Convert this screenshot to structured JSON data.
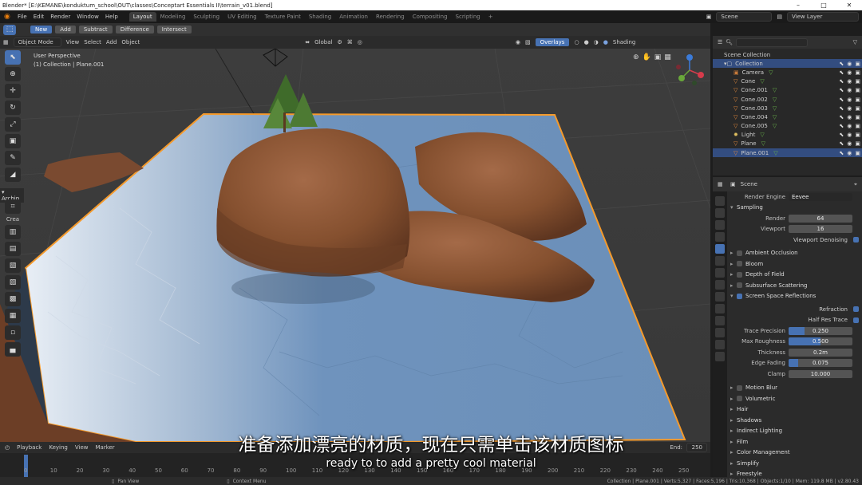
{
  "window": {
    "title": "Blender* [E:\\KEMANE\\konduktum_school\\OUT\\classes\\Conceptart Essentials II\\terrain_v01.blend]"
  },
  "menubar": {
    "menus": [
      "File",
      "Edit",
      "Render",
      "Window",
      "Help"
    ],
    "workspaces": [
      "Layout",
      "Modeling",
      "Sculpting",
      "UV Editing",
      "Texture Paint",
      "Shading",
      "Animation",
      "Rendering",
      "Compositing",
      "Scripting"
    ],
    "active_workspace": "Layout",
    "scene": "Scene",
    "view_layer": "View Layer"
  },
  "tool_header": {
    "new": "New",
    "add": "Add",
    "subtract": "Subtract",
    "difference": "Difference",
    "intersect": "Intersect"
  },
  "viewport_header": {
    "mode": "Object Mode",
    "view": "View",
    "select": "Select",
    "add": "Add",
    "object": "Object",
    "orientation": "Global",
    "overlays": "Overlays",
    "shading": "Shading"
  },
  "viewport": {
    "perspective": "User Perspective",
    "collection_info": "(1) Collection | Plane.001"
  },
  "toolbar": {
    "archip_label": "Archip",
    "crea_label": "Crea"
  },
  "outliner": {
    "root": "Scene Collection",
    "collection": "Collection",
    "items": [
      "Camera",
      "Cone",
      "Cone.001",
      "Cone.002",
      "Cone.003",
      "Cone.004",
      "Cone.005",
      "Light",
      "Plane",
      "Plane.001"
    ]
  },
  "properties": {
    "tab": "Scene",
    "render_engine_label": "Render Engine",
    "render_engine": "Eevee",
    "sampling": {
      "title": "Sampling",
      "render_label": "Render",
      "render": "64",
      "viewport_label": "Viewport",
      "viewport": "16",
      "denoise_label": "Viewport Denoising"
    },
    "sections_top": [
      "Ambient Occlusion",
      "Bloom",
      "Depth of Field",
      "Subsurface Scattering"
    ],
    "ssr": {
      "title": "Screen Space Reflections",
      "refraction": "Refraction",
      "half_res": "Half Res Trace",
      "trace_precision_label": "Trace Precision",
      "trace_precision": "0.250",
      "trace_precision_frac": 0.25,
      "max_roughness_label": "Max Roughness",
      "max_roughness": "0.500",
      "max_roughness_frac": 0.5,
      "thickness_label": "Thickness",
      "thickness": "0.2m",
      "edge_fading_label": "Edge Fading",
      "edge_fading": "0.075",
      "edge_fading_frac": 0.15,
      "clamp_label": "Clamp",
      "clamp": "10.000"
    },
    "sections_bottom": [
      "Motion Blur",
      "Volumetric",
      "Hair",
      "Shadows",
      "Indirect Lighting",
      "Film",
      "Color Management",
      "Simplify",
      "Freestyle"
    ]
  },
  "timeline": {
    "playback": "Playback",
    "keying": "Keying",
    "view": "View",
    "marker": "Marker",
    "end_label": "End:",
    "end": "250",
    "ticks": [
      "0",
      "10",
      "20",
      "30",
      "40",
      "50",
      "60",
      "70",
      "80",
      "90",
      "100",
      "110",
      "120",
      "130",
      "140",
      "150",
      "160",
      "170",
      "180",
      "190",
      "200",
      "210",
      "220",
      "230",
      "240",
      "250"
    ],
    "current_frame": "1"
  },
  "statusbar": {
    "pan": "Pan View",
    "context": "Context Menu",
    "stats": "Collection | Plane.001 | Verts:5,327 | Faces:5,196 | Tris:10,368 | Objects:1/10 | Mem: 119.8 MB | v2.80.43"
  },
  "subtitle": {
    "zh": "准备添加漂亮的材质，现在只需单击该材质图标",
    "en": "ready to to add a pretty cool material"
  },
  "colors": {
    "accent": "#4772b3",
    "water": "#6f93bd",
    "terrain": "#8a5436",
    "selection_outline": "#f59a2b"
  }
}
